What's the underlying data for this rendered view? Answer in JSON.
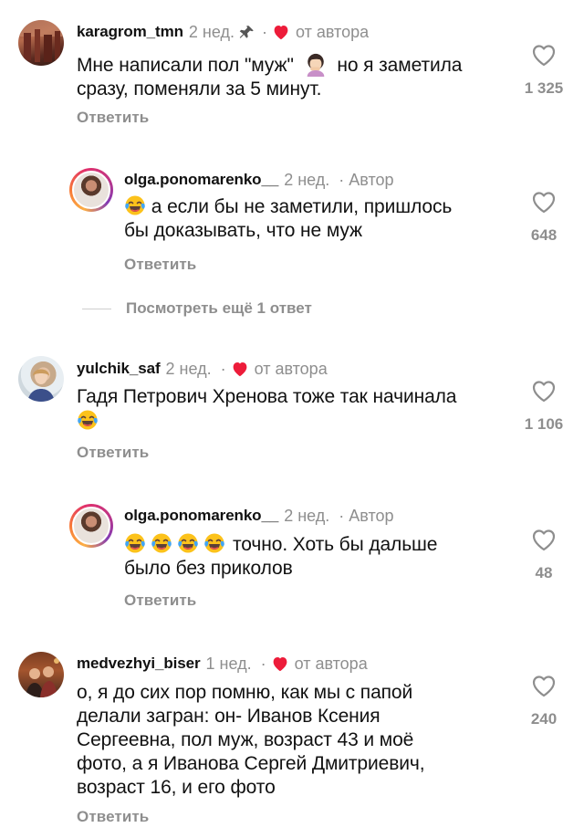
{
  "comments": [
    {
      "username": "karagrom_tmn",
      "time": "2 нед.",
      "author_like": "от автора",
      "text_before_emoji": "Мне написали пол \"муж\"",
      "text_after_emoji": "но я заметила",
      "text_line2": "сразу, поменяли за 5 минут.",
      "reply_label": "Ответить",
      "likes": "1 325",
      "pinned": true
    },
    {
      "username": "olga.ponomarenko__",
      "time": "2 нед.",
      "author_label": "Автор",
      "text_line1": "а если бы не заметили, пришлось",
      "text_line2": "бы доказывать, что не муж",
      "reply_label": "Ответить",
      "likes": "648"
    },
    {
      "username": "yulchik_saf",
      "time": "2 нед.",
      "author_like": "от автора",
      "text_line1": "Гадя Петрович Хренова тоже так начинала",
      "reply_label": "Ответить",
      "likes": "1 106"
    },
    {
      "username": "olga.ponomarenko__",
      "time": "2 нед.",
      "author_label": "Автор",
      "text_line1": "точно. Хоть бы дальше",
      "text_line2": "было без приколов",
      "reply_label": "Ответить",
      "likes": "48"
    },
    {
      "username": "medvezhyi_biser",
      "time": "1 нед.",
      "author_like": "от автора",
      "lines": [
        "о, я до сих пор помню, как мы с папой",
        "делали загран: он- Иванов Ксения",
        "Сергеевна, пол муж, возраст 43 и моё",
        "фото, а я Иванова Сергей Дмитриевич,",
        "возраст 16, и его фото"
      ],
      "reply_label": "Ответить",
      "likes": "240"
    }
  ],
  "view_more_replies": "Посмотреть ещё 1 ответ",
  "icons": {
    "like": "heart-outline-icon",
    "author_like": "red-heart-icon",
    "pin": "pin-icon",
    "emoji_laugh": "tears-of-joy-emoji",
    "emoji_woman": "woman-facepalming-emoji"
  },
  "colors": {
    "author_heart": "#ed1c3a",
    "secondary_text": "#8e8e8e"
  }
}
